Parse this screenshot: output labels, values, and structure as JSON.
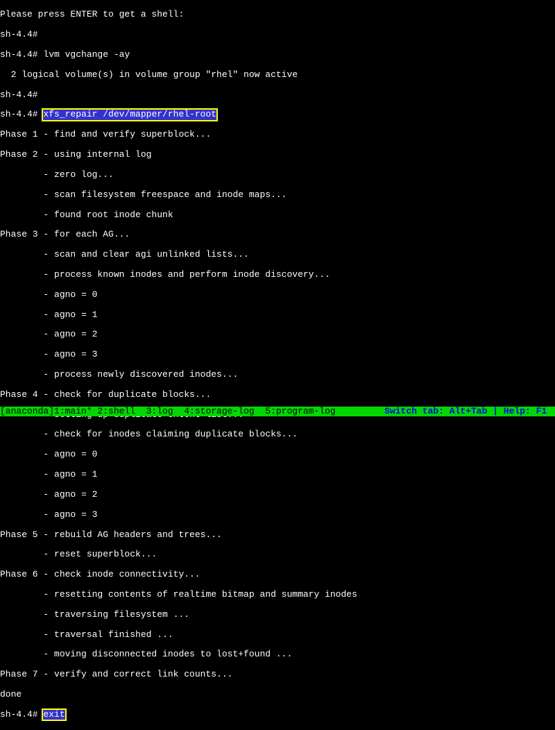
{
  "lines": {
    "l0": "Please press ENTER to get a shell:",
    "l1p": "sh-4.4#",
    "l2p": "sh-4.4# ",
    "l2c": "lvm vgchange -ay",
    "l3": "  2 logical volume(s) in volume group \"rhel\" now active",
    "l4p": "sh-4.4#",
    "l5p": "sh-4.4# ",
    "l5h": "xfs_repair /dev/mapper/rhel-root",
    "l6": "Phase 1 - find and verify superblock...",
    "l7": "Phase 2 - using internal log",
    "l8": "        - zero log...",
    "l9": "        - scan filesystem freespace and inode maps...",
    "l10": "        - found root inode chunk",
    "l11": "Phase 3 - for each AG...",
    "l12": "        - scan and clear agi unlinked lists...",
    "l13": "        - process known inodes and perform inode discovery...",
    "l14": "        - agno = 0",
    "l15": "        - agno = 1",
    "l16": "        - agno = 2",
    "l17": "        - agno = 3",
    "l18": "        - process newly discovered inodes...",
    "l19": "Phase 4 - check for duplicate blocks...",
    "l20": "        - setting up duplicate extent list...",
    "l21": "        - check for inodes claiming duplicate blocks...",
    "l22": "        - agno = 0",
    "l23": "        - agno = 1",
    "l24": "        - agno = 2",
    "l25": "        - agno = 3",
    "l26": "Phase 5 - rebuild AG headers and trees...",
    "l27": "        - reset superblock...",
    "l28": "Phase 6 - check inode connectivity...",
    "l29": "        - resetting contents of realtime bitmap and summary inodes",
    "l30": "        - traversing filesystem ...",
    "l31": "        - traversal finished ...",
    "l32": "        - moving disconnected inodes to lost+found ...",
    "l33": "Phase 7 - verify and correct link counts...",
    "l34": "done",
    "l35p": "sh-4.4# ",
    "l35h": "exit"
  },
  "status": {
    "left": "[anaconda]1:main* 2:shell  3:log  4:storage-log  5:program-log",
    "right": "Switch tab: Alt+Tab | Help: F1 "
  }
}
